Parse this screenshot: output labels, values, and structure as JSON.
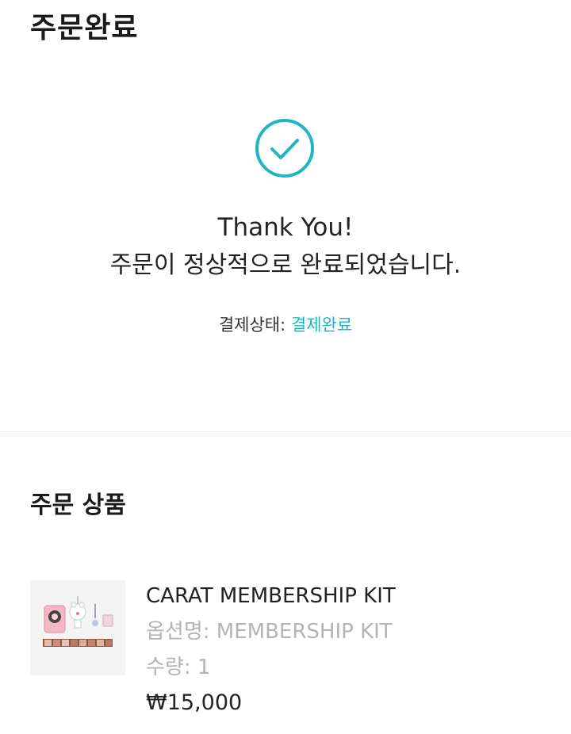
{
  "header": {
    "title": "주문완료"
  },
  "confirmation": {
    "icon": "check-circle-icon",
    "accent_color": "#1fb5c2",
    "thank_you": "Thank You!",
    "message": "주문이 정상적으로 완료되었습니다.",
    "payment_status_label": "결제상태: ",
    "payment_status_value": "결제완료"
  },
  "order_products": {
    "section_title": "주문 상품",
    "items": [
      {
        "name": "CARAT MEMBERSHIP KIT",
        "option": "옵션명: MEMBERSHIP KIT",
        "quantity": "수량: 1",
        "price": "₩15,000"
      }
    ]
  }
}
